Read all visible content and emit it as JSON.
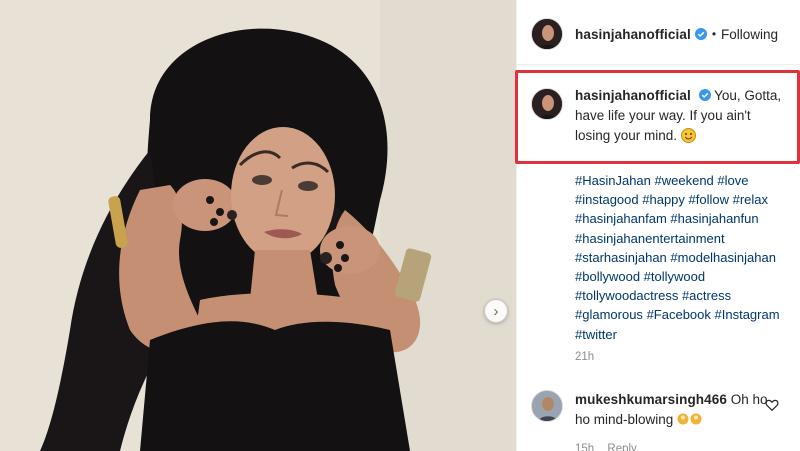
{
  "post": {
    "username": "hasinjahanofficial",
    "verified": true,
    "separator": "•",
    "follow_status": "Following",
    "caption": "You, Gotta, have life your way. If you ain't losing your mind.",
    "hashtags": [
      "#HasinJahan",
      "#weekend",
      "#love",
      "#instagood",
      "#happy",
      "#follow",
      "#relax",
      "#hasinjahanfam",
      "#hasinjahanfun",
      "#hasinjahanentertainment",
      "#starhasinjahan",
      "#modelhasinjahan",
      "#bollywood",
      "#tollywood",
      "#tollywoodactress",
      "#actress",
      "#glamorous",
      "#Facebook",
      "#Instagram",
      "#twitter"
    ],
    "timestamp": "21h"
  },
  "comment": {
    "username": "mukeshkumarsingh466",
    "text": "Oh ho ho mind-blowing",
    "time": "15h",
    "reply_label": "Reply"
  },
  "icons": {
    "verified": "verified-badge-icon",
    "emoji": "smiling-face-icon",
    "heart": "heart-icon",
    "carousel": "chevron-right-icon"
  },
  "colors": {
    "link": "#00376b",
    "verified": "#3897f0",
    "highlight_box": "#e0323c",
    "muted": "#8e8e8e"
  }
}
